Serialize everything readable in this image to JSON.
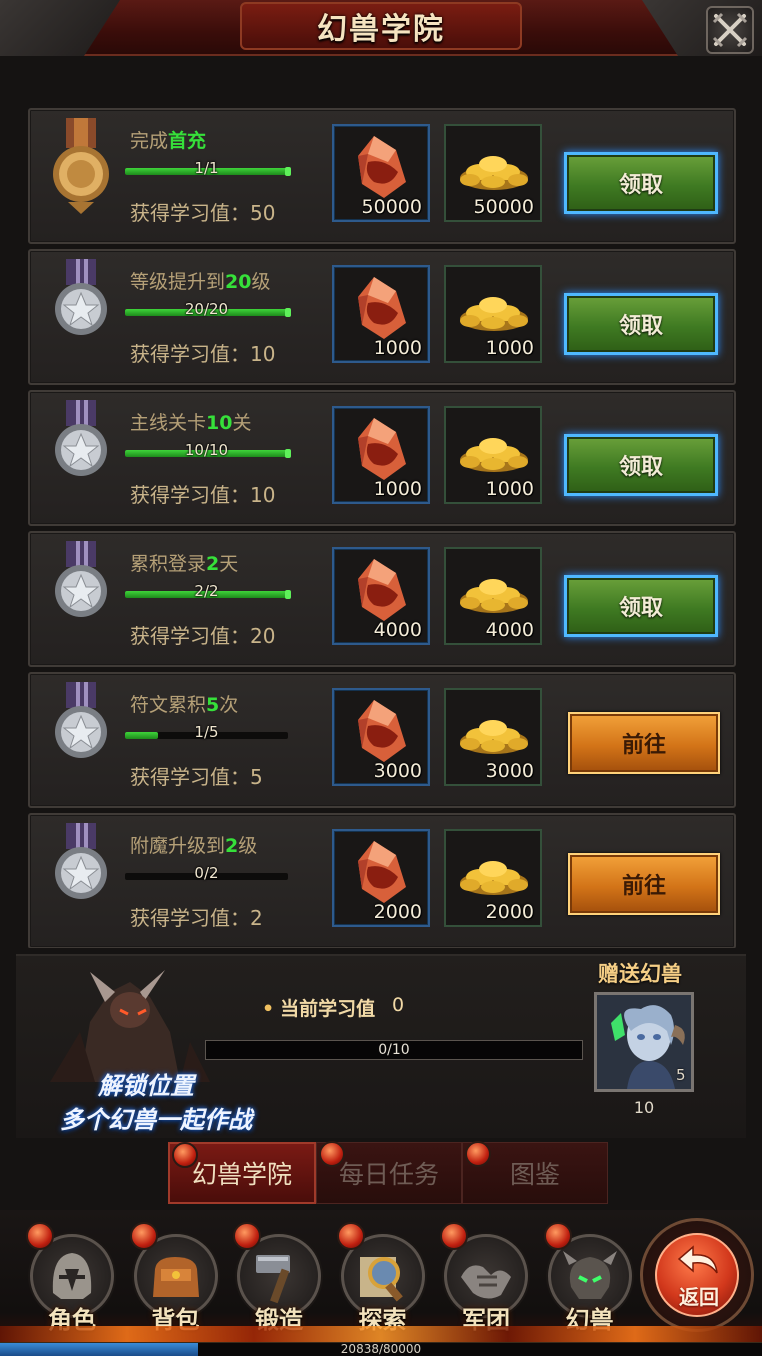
{
  "header": {
    "title": "幻兽学院"
  },
  "tasks": [
    {
      "name_prefix": "完成",
      "name_highlight": "首充",
      "name_suffix": "",
      "progress_text": "1/1",
      "progress": 1.0,
      "reward_label": "获得学习值：50",
      "items": [
        {
          "icon": "red-crystal-icon",
          "qty": "50000"
        },
        {
          "icon": "gold-ingots-icon",
          "qty": "50000"
        }
      ],
      "button": {
        "type": "claim",
        "label": "领取"
      },
      "medal": "gold-medal-icon"
    },
    {
      "name_prefix": "等级提升到",
      "name_highlight": "20",
      "name_suffix": "级",
      "progress_text": "20/20",
      "progress": 1.0,
      "reward_label": "获得学习值：10",
      "items": [
        {
          "icon": "red-crystal-icon",
          "qty": "1000"
        },
        {
          "icon": "gold-ingots-icon",
          "qty": "1000"
        }
      ],
      "button": {
        "type": "claim",
        "label": "领取"
      },
      "medal": "silver-medal-icon"
    },
    {
      "name_prefix": "主线关卡",
      "name_highlight": "10",
      "name_suffix": "关",
      "progress_text": "10/10",
      "progress": 1.0,
      "reward_label": "获得学习值：10",
      "items": [
        {
          "icon": "red-crystal-icon",
          "qty": "1000"
        },
        {
          "icon": "gold-ingots-icon",
          "qty": "1000"
        }
      ],
      "button": {
        "type": "claim",
        "label": "领取"
      },
      "medal": "silver-medal-icon"
    },
    {
      "name_prefix": "累积登录",
      "name_highlight": "2",
      "name_suffix": "天",
      "progress_text": "2/2",
      "progress": 1.0,
      "reward_label": "获得学习值：20",
      "items": [
        {
          "icon": "red-crystal-icon",
          "qty": "4000"
        },
        {
          "icon": "gold-ingots-icon",
          "qty": "4000"
        }
      ],
      "button": {
        "type": "claim",
        "label": "领取"
      },
      "medal": "silver-medal-icon"
    },
    {
      "name_prefix": "符文累积",
      "name_highlight": "5",
      "name_suffix": "次",
      "progress_text": "1/5",
      "progress": 0.2,
      "reward_label": "获得学习值：5",
      "items": [
        {
          "icon": "red-crystal-icon",
          "qty": "3000"
        },
        {
          "icon": "gold-ingots-icon",
          "qty": "3000"
        }
      ],
      "button": {
        "type": "go",
        "label": "前往"
      },
      "medal": "silver-medal-icon"
    },
    {
      "name_prefix": "附魔升级到",
      "name_highlight": "2",
      "name_suffix": "级",
      "progress_text": "0/2",
      "progress": 0.0,
      "reward_label": "获得学习值：2",
      "items": [
        {
          "icon": "red-crystal-icon",
          "qty": "2000"
        },
        {
          "icon": "gold-ingots-icon",
          "qty": "2000"
        }
      ],
      "button": {
        "type": "go",
        "label": "前往"
      },
      "medal": "silver-medal-icon"
    }
  ],
  "study": {
    "label": "当前学习值",
    "value": "0",
    "bar_text": "0/10",
    "progress": 0.0
  },
  "unlock": {
    "line1": "解锁位置",
    "line2": "多个幻兽一起作战"
  },
  "gift": {
    "title": "赠送幻兽",
    "count": "5",
    "requirement": "10",
    "icon": "beast-portrait-icon"
  },
  "tabs": [
    {
      "label": "幻兽学院",
      "active": true
    },
    {
      "label": "每日任务",
      "active": false
    },
    {
      "label": "图鉴",
      "active": false
    }
  ],
  "nav": [
    {
      "label": "角色",
      "icon": "helmet-icon"
    },
    {
      "label": "背包",
      "icon": "bag-icon"
    },
    {
      "label": "锻造",
      "icon": "hammer-icon"
    },
    {
      "label": "探索",
      "icon": "magnifier-icon"
    },
    {
      "label": "军团",
      "icon": "handshake-icon"
    },
    {
      "label": "幻兽",
      "icon": "beast-icon"
    }
  ],
  "back": {
    "label": "返回"
  },
  "exp": {
    "text": "20838/80000",
    "progress": 0.26
  }
}
